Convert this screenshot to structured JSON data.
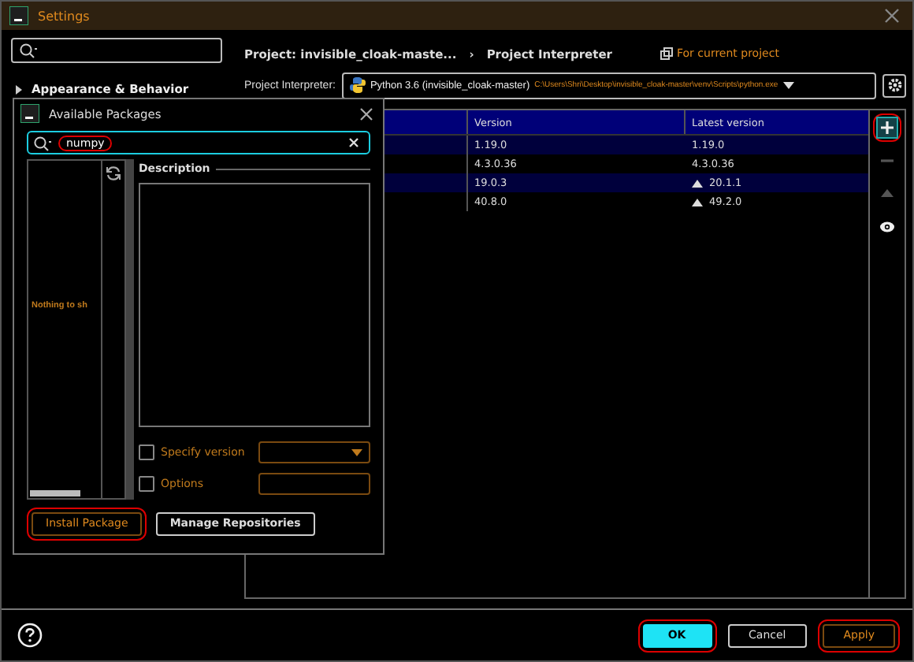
{
  "window": {
    "title": "Settings"
  },
  "sidebar": {
    "items": [
      {
        "label": "Appearance & Behavior",
        "expanded": false
      }
    ]
  },
  "breadcrumb": {
    "items": [
      "Project: invisible_cloak-maste...",
      "Project Interpreter"
    ],
    "separator": "›",
    "scope": "For current project"
  },
  "interpreter": {
    "label": "Project Interpreter:",
    "name": "Python 3.6 (invisible_cloak-master)",
    "path": "C:\\Users\\Shri\\Desktop\\invisible_cloak-master\\venv\\Scripts\\python.exe"
  },
  "table": {
    "columns": [
      "Version",
      "Latest version"
    ],
    "rows": [
      {
        "version": "1.19.0",
        "latest": "1.19.0",
        "upgrade": false,
        "highlighted": true
      },
      {
        "version": "4.3.0.36",
        "latest": "4.3.0.36",
        "upgrade": false,
        "highlighted": false
      },
      {
        "version": "19.0.3",
        "latest": "20.1.1",
        "upgrade": true,
        "highlighted": true
      },
      {
        "version": "40.8.0",
        "latest": "49.2.0",
        "upgrade": true,
        "highlighted": false
      }
    ]
  },
  "toolbar": [
    {
      "kind": "add",
      "disabled": false,
      "circled": true
    },
    {
      "kind": "remove",
      "disabled": true,
      "circled": false
    },
    {
      "kind": "upgrade",
      "disabled": true,
      "circled": false
    },
    {
      "kind": "show",
      "disabled": false,
      "circled": false
    }
  ],
  "dialog": {
    "title": "Available Packages",
    "search": {
      "value": "numpy",
      "circled": true
    },
    "empty_text": "Nothing to sh",
    "description_label": "Description",
    "specify_version": {
      "label": "Specify version",
      "checked": false
    },
    "options": {
      "label": "Options",
      "checked": false
    },
    "buttons": [
      {
        "label": "Install Package",
        "kind": "accent",
        "circled": true
      },
      {
        "label": "Manage Repositories",
        "kind": "default",
        "circled": false
      }
    ]
  },
  "footer": {
    "buttons": [
      {
        "label": "OK",
        "kind": "primary",
        "circled": true
      },
      {
        "label": "Cancel",
        "kind": "default",
        "circled": false
      },
      {
        "label": "Apply",
        "kind": "accent",
        "circled": true
      }
    ]
  }
}
